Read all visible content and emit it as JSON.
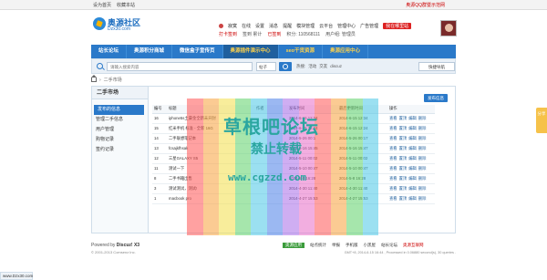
{
  "topbar": {
    "links": [
      "设为首页",
      "收藏本站"
    ],
    "right": "奥源QQ群暨示范网"
  },
  "logo": {
    "name": "奥源社区",
    "domain": "Dzx30.com"
  },
  "user": {
    "name": "寂寞",
    "items": [
      "在线",
      "设置",
      "消息",
      "提醒",
      "模块管理",
      "云平台",
      "管理中心",
      "广告管理"
    ],
    "badge": "我在哪里站",
    "row2": [
      "打卡签到",
      "签到 累计",
      "积分: 110568111",
      "用户组: 管理员"
    ],
    "row2_red": "已签到"
  },
  "nav": {
    "items": [
      "站长论坛",
      "奥源积分商城",
      "微信盒子宣传页",
      "奥源插件演示中心",
      "seo干货资源",
      "奥源应用中心"
    ]
  },
  "search": {
    "placeholder": "请输入搜索内容",
    "type": "帖子",
    "hot_label": "热搜:",
    "hot": [
      "活动",
      "交友",
      "discuz"
    ],
    "quick": "快捷导航"
  },
  "breadcrumb": [
    "二手市场"
  ],
  "sidebar": {
    "title": "二手市场",
    "items": [
      "发布的信息",
      "管理二手信息",
      "用户管理",
      "购物记录",
      "签约记录"
    ]
  },
  "main": {
    "publish": "发布信息",
    "columns": [
      "编号",
      "标题",
      "作者",
      "发布时间",
      "最后更新时间",
      "操作"
    ],
    "rows": [
      {
        "id": "16",
        "title": "iphone5s土豪金全新未开封",
        "author": "",
        "pub": "2014-6-15 12:34",
        "upd": "2014-6-15 12:34",
        "ops": [
          "查看",
          "置顶",
          "编辑",
          "删除"
        ]
      },
      {
        "id": "15",
        "title": "红米手机 标准 - 全新 16G",
        "author": "",
        "pub": "2014-6-15 12:24",
        "upd": "2014-6-15 12:24",
        "ops": [
          "查看",
          "置顶",
          "编辑",
          "删除"
        ]
      },
      {
        "id": "14",
        "title": "二手联想笔记本",
        "author": "",
        "pub": "2014-5-26 00:1",
        "upd": "2014-5-26 00:17",
        "ops": [
          "查看",
          "置顶",
          "编辑",
          "删除"
        ]
      },
      {
        "id": "13",
        "title": "fcsajkfhsak",
        "author": "",
        "pub": "2014-5-16 15:45",
        "upd": "2014-5-16 15:47",
        "ops": [
          "查看",
          "置顶",
          "编辑",
          "删除"
        ]
      },
      {
        "id": "12",
        "title": "三星GALAXY S5",
        "author": "",
        "pub": "2014-5-11 00:02",
        "upd": "2014-5-11 00:02",
        "ops": [
          "查看",
          "置顶",
          "编辑",
          "删除"
        ]
      },
      {
        "id": "11",
        "title": "测试一下",
        "author": "",
        "pub": "2014-5-10 00:47",
        "upd": "2014-5-10 00:47",
        "ops": [
          "查看",
          "置顶",
          "编辑",
          "删除"
        ]
      },
      {
        "id": "8",
        "title": "二手书籍出售",
        "author": "",
        "pub": "2014-5-8 16:28",
        "upd": "2014-5-8 16:28",
        "ops": [
          "查看",
          "置顶",
          "编辑",
          "删除"
        ]
      },
      {
        "id": "3",
        "title": "测试测试，测试!",
        "author": "",
        "pub": "2014-4-30 11:40",
        "upd": "2014-4-30 11:40",
        "ops": [
          "查看",
          "置顶",
          "编辑",
          "删除"
        ]
      },
      {
        "id": "1",
        "title": "macbook pro",
        "author": "",
        "pub": "2014-4-27 15:53",
        "upd": "2014-4-27 15:53",
        "ops": [
          "查看",
          "置顶",
          "编辑",
          "删除"
        ]
      }
    ]
  },
  "footer": {
    "powered": "Powered by",
    "product": "Discuz! X3",
    "copyright": "© 2001-2013 Comsenz Inc.",
    "links": [
      "奥源应用",
      "站点统计",
      "举报",
      "手机版",
      "小黑屋",
      "站长论坛"
    ],
    "red_link": "奥源互联网",
    "time": "GMT+8, 2014-6-15 16:44 , Processed in 0.06880 second(s), 30 queries ."
  },
  "url": "www.Dzx30.com",
  "sidetab": "分享",
  "watermark": {
    "line1": "草根吧论坛",
    "line2": "禁止转载",
    "line3": "www.cgzzd.com"
  }
}
